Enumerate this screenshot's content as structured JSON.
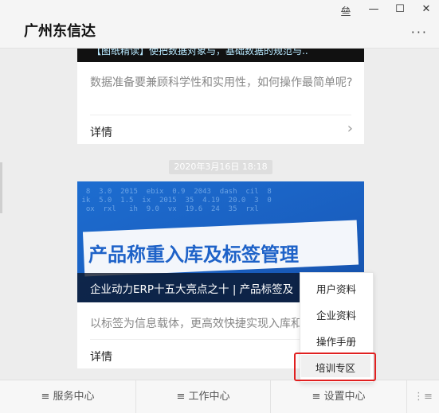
{
  "window": {
    "title": "广州东信达",
    "controls": {
      "pin": "亝",
      "minimize": "—",
      "maximize": "☐",
      "close": "✕"
    },
    "more": "···"
  },
  "feed": {
    "card1": {
      "banner_text": "【图纸精读】使把数据对象与，基础数据的规范与..",
      "description": "数据准备要兼顾科学性和实用性，如何操作最简单呢?",
      "detail_label": "详情"
    },
    "timestamp": "2020年3月16日 18:18",
    "card2": {
      "banner_title": "产品称重入库及标签管理",
      "caption": "企业动力ERP十五大亮点之十 | 产品标签及",
      "description": "以标签为信息载体，更高效快捷实现入库和",
      "detail_label": "详情"
    }
  },
  "popup_menu": {
    "items": [
      "用户资料",
      "企业资料",
      "操作手册",
      "培训专区"
    ],
    "highlighted": "培训专区"
  },
  "tabbar": {
    "tabs": [
      "服务中心",
      "工作中心",
      "设置中心"
    ],
    "menu_glyph": "≡"
  }
}
